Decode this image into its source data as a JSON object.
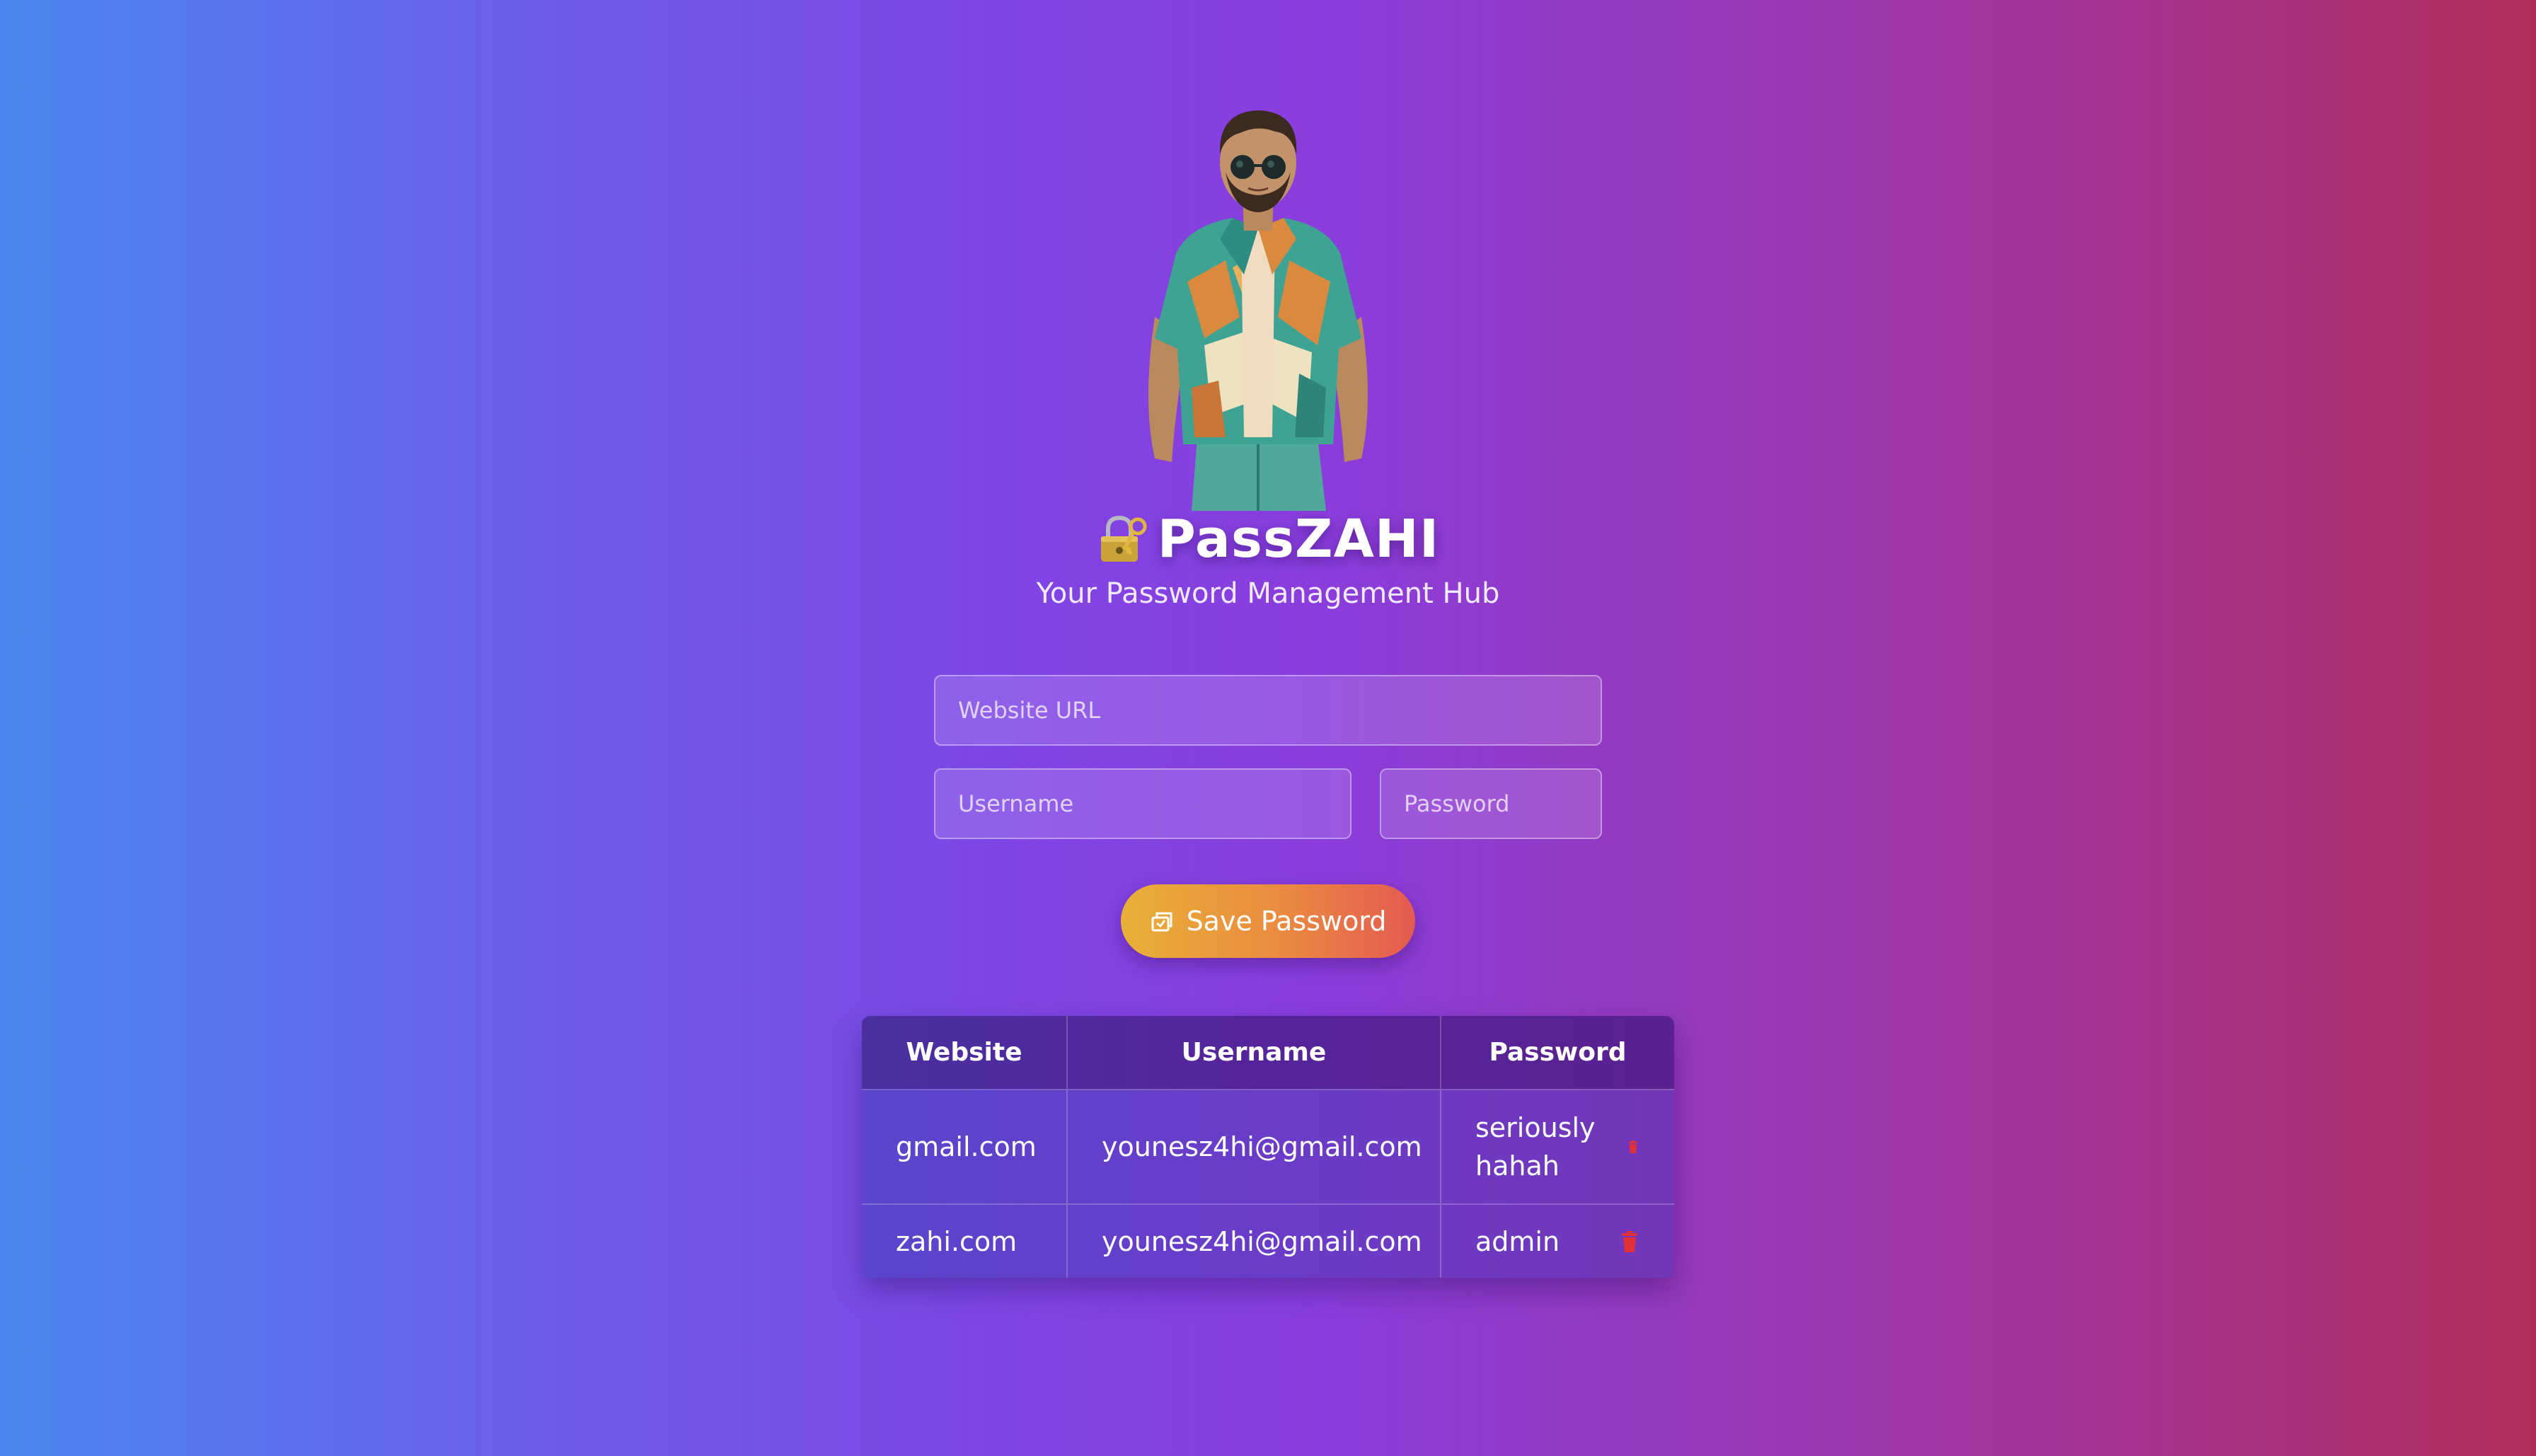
{
  "app": {
    "title": "PassZAHI",
    "subtitle": "Your Password Management Hub",
    "lock_icon": "locked-with-key-icon"
  },
  "form": {
    "url_placeholder": "Website URL",
    "username_placeholder": "Username",
    "password_placeholder": "Password",
    "save_label": "Save Password",
    "save_icon": "save-icon"
  },
  "table": {
    "headers": [
      "Website",
      "Username",
      "Password"
    ],
    "rows": [
      {
        "website": "gmail.com",
        "username": "younesz4hi@gmail.com",
        "password": "seriously hahah"
      },
      {
        "website": "zahi.com",
        "username": "younesz4hi@gmail.com",
        "password": "admin"
      }
    ],
    "delete_icon": "trash-icon"
  },
  "colors": {
    "gradient_left": "#4a87ef",
    "gradient_mid": "#8a3ddc",
    "gradient_right": "#b02d5a",
    "button_start": "#e8b038",
    "button_end": "#e45a52",
    "delete_red": "#e0303a"
  }
}
